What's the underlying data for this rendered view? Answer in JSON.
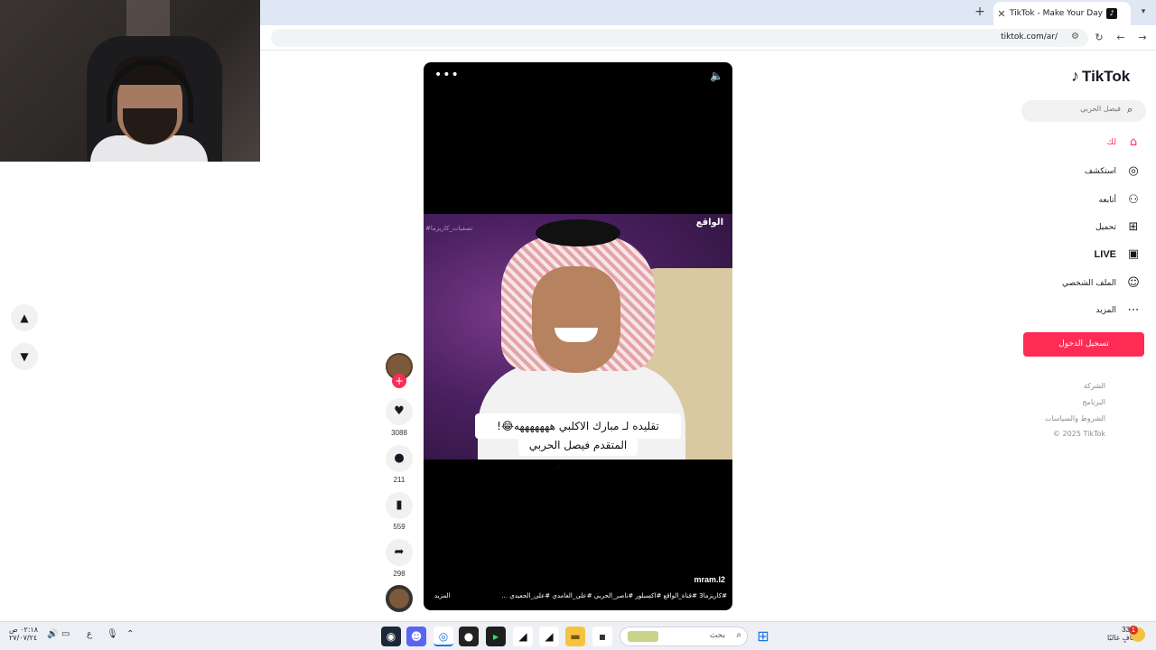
{
  "browser": {
    "tab_title": "TikTok - Make Your Day",
    "tab_favicon": "tiktok-icon",
    "url": "tiktok.com/ar/",
    "new_tab": "+",
    "close": "✕"
  },
  "tiktok": {
    "logo_text": "TikTok",
    "search_placeholder": "فيصل الحربي",
    "nav": [
      {
        "label": "لك",
        "icon": "home-icon",
        "active": true
      },
      {
        "label": "استكشف",
        "icon": "compass-icon"
      },
      {
        "label": "أتابعه",
        "icon": "following-icon"
      },
      {
        "label": "تحميل",
        "icon": "upload-icon"
      },
      {
        "label": "LIVE",
        "icon": "live-icon"
      },
      {
        "label": "الملف الشخصي",
        "icon": "profile-icon"
      },
      {
        "label": "المزيد",
        "icon": "more-icon"
      }
    ],
    "login_label": "تسجيل الدخول",
    "footer": [
      "الشركة",
      "البرنامج",
      "الشروط والسياسات",
      "© 2025 TikTok"
    ],
    "accent_color": "#fe2c55"
  },
  "video": {
    "channel_tag": "الواقع",
    "watermark": "#تصفيات_كاريزما",
    "caption_line1": "تقليده لـ مبارك الاكلبي هههههههه😂!",
    "caption_line2": "المتقدم فيصل الحربي",
    "author": "mram.l2",
    "hashtags": "#كاريزما3 #قناة_الواقع #اكسبلور #ناصر_الحربي #علي_الغامدي #علي_الجعيدي ...",
    "more_label": "المزيد",
    "likes": "3088",
    "comments": "211",
    "saves": "559",
    "shares": "298"
  },
  "taskbar": {
    "search_label": "بحث",
    "temperature": "33°C",
    "weather_condition": "صافٍ غالبًا",
    "notification_count": "1",
    "time": "٠٢:١٨ ص",
    "date": "٢٧/٠٧/٢٤",
    "language": "ع"
  }
}
